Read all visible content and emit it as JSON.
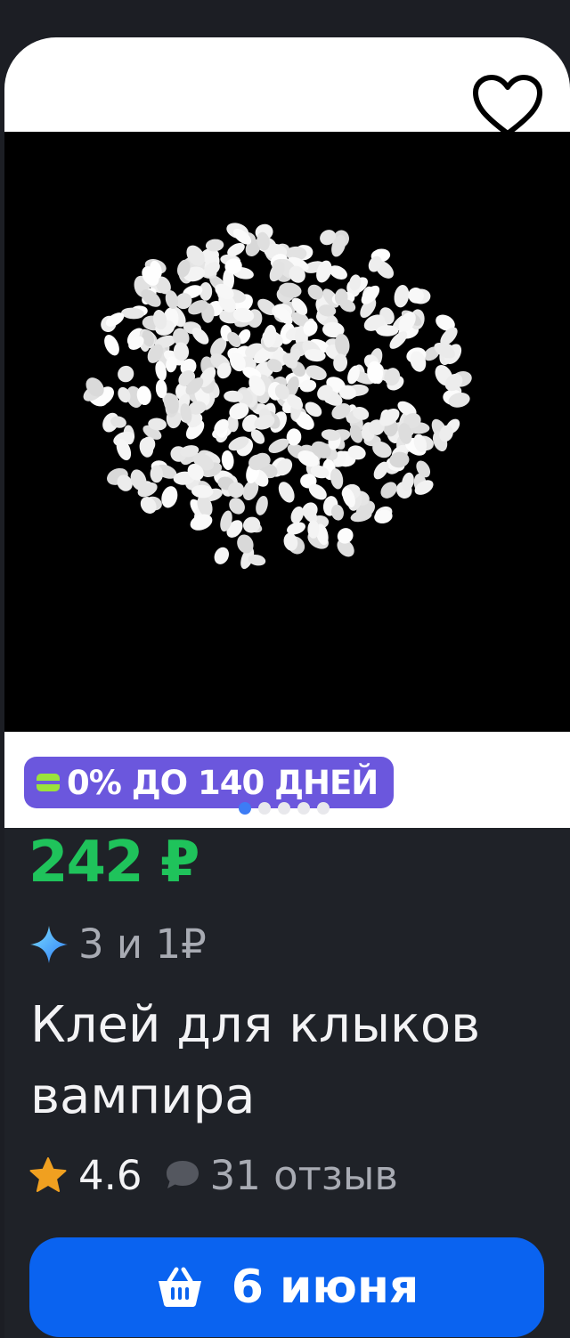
{
  "product": {
    "promo_badge": "0% ДО 140 ДНЕЙ",
    "price": "242 ₽",
    "bonus_text": "3 и 1₽",
    "title": "Клей для клыков вампира",
    "rating": "4.6",
    "reviews": "31 отзыв"
  },
  "gallery": {
    "slide_count": 5,
    "active_index": 0
  },
  "cta": {
    "label": "6 июня"
  },
  "icons": {
    "favorite": "heart-icon",
    "promo": "card-icon",
    "bonus": "sparkle-icon",
    "rating": "star-icon",
    "reviews": "speech-bubble-icon",
    "cart": "basket-icon"
  },
  "colors": {
    "price_green": "#1fc35b",
    "promo_purple": "#6b57dd",
    "cta_blue": "#0a63f0",
    "star_orange": "#f0a020",
    "active_dot": "#3d7cf5"
  }
}
